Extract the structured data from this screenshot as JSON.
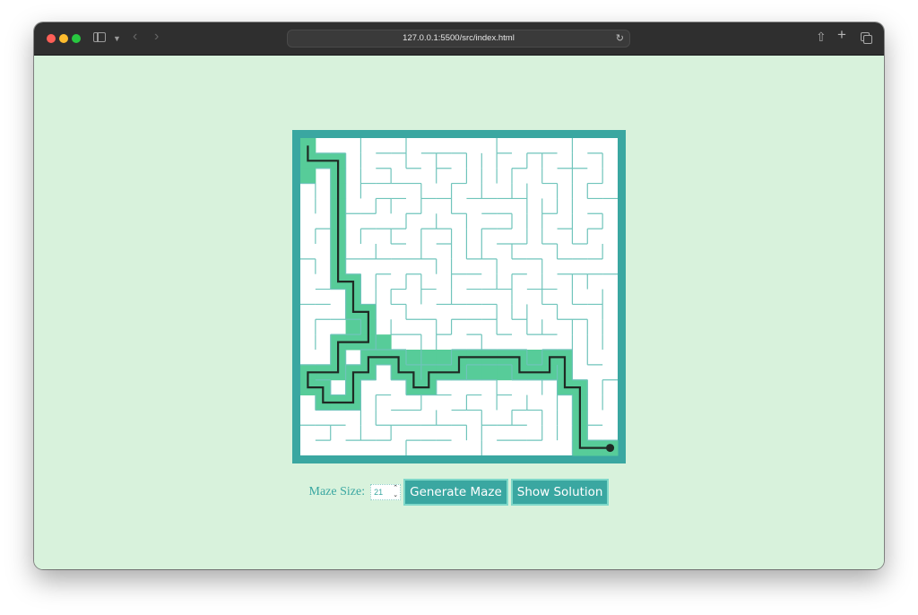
{
  "browser": {
    "url": "127.0.0.1:5500/src/index.html",
    "icons": [
      "close-dot",
      "minimize-dot",
      "zoom-dot",
      "sidebar-icon",
      "chevron-down-icon",
      "back-icon",
      "forward-icon",
      "reload-icon",
      "share-icon",
      "new-tab-icon",
      "tab-overview-icon"
    ]
  },
  "colors": {
    "page_background": "#d8f2dc",
    "maze_border": "#3aa7a1",
    "wall": "#6fc4bb",
    "visited": "#57cc99",
    "path": "#1f2a24",
    "button": "#3aa7a1",
    "button_border": "#7ed8c9",
    "label": "#3aa7a1"
  },
  "maze": {
    "size": 21,
    "start": [
      0,
      0
    ],
    "end": [
      20,
      20
    ],
    "solution_path": [
      [
        0,
        0
      ],
      [
        0,
        1
      ],
      [
        2,
        1
      ],
      [
        2,
        9
      ],
      [
        3,
        9
      ],
      [
        3,
        11
      ],
      [
        4,
        11
      ],
      [
        4,
        13
      ],
      [
        2,
        13
      ],
      [
        2,
        15
      ],
      [
        0,
        15
      ],
      [
        0,
        16
      ],
      [
        1,
        16
      ],
      [
        1,
        17
      ],
      [
        3,
        17
      ],
      [
        3,
        15
      ],
      [
        4,
        15
      ],
      [
        4,
        14
      ],
      [
        6,
        14
      ],
      [
        6,
        15
      ],
      [
        7,
        15
      ],
      [
        7,
        16
      ],
      [
        8,
        16
      ],
      [
        8,
        15
      ],
      [
        10,
        15
      ],
      [
        10,
        14
      ],
      [
        14,
        14
      ],
      [
        14,
        15
      ],
      [
        16,
        15
      ],
      [
        16,
        14
      ],
      [
        17,
        14
      ],
      [
        17,
        16
      ],
      [
        18,
        16
      ],
      [
        18,
        20
      ],
      [
        20,
        20
      ]
    ],
    "extra_visited_cells": [
      [
        3,
        12
      ],
      [
        1,
        15
      ],
      [
        3,
        16
      ],
      [
        7,
        14
      ],
      [
        8,
        14
      ],
      [
        9,
        14
      ],
      [
        9,
        15
      ],
      [
        11,
        15
      ],
      [
        12,
        15
      ],
      [
        13,
        15
      ],
      [
        15,
        14
      ],
      [
        17,
        15
      ],
      [
        5,
        13
      ],
      [
        3,
        10
      ],
      [
        0,
        2
      ]
    ]
  },
  "controls": {
    "size_label": "Maze Size:",
    "size_value": "21",
    "generate_label": "Generate Maze",
    "solution_label": "Show Solution"
  }
}
